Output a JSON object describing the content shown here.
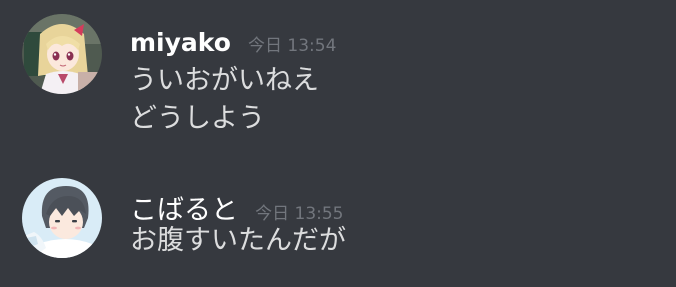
{
  "theme": {
    "background": "#36393f",
    "username_color": "#ffffff",
    "timestamp_color": "#72767d",
    "text_color": "#dcddde"
  },
  "messages": [
    {
      "avatar_icon": "anime-girl-avatar-icon",
      "username": "miyako",
      "timestamp": "今日 13:54",
      "lines": [
        "ういおがいねえ",
        "どうしよう"
      ]
    },
    {
      "avatar_icon": "anime-boy-avatar-icon",
      "username": "こばると",
      "timestamp": "今日 13:55",
      "lines": [
        "お腹すいたんだが"
      ]
    }
  ]
}
